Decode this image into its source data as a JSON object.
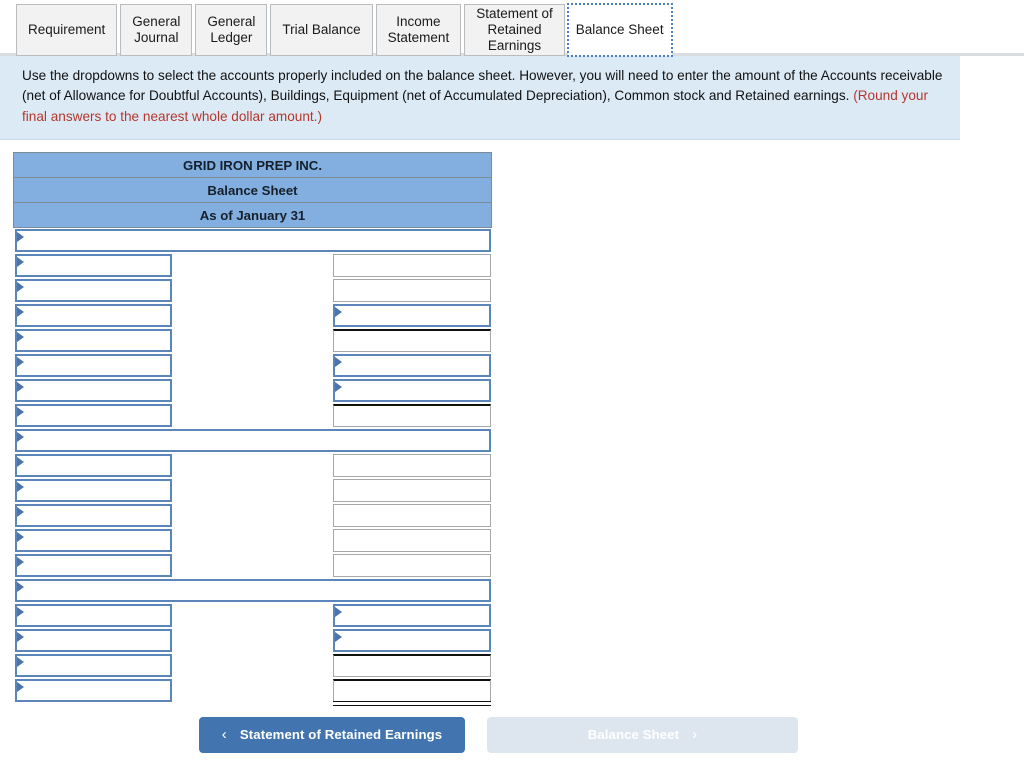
{
  "tabs": [
    {
      "label": "Requirement",
      "active": false
    },
    {
      "label": "General\nJournal",
      "active": false
    },
    {
      "label": "General\nLedger",
      "active": false
    },
    {
      "label": "Trial Balance",
      "active": false
    },
    {
      "label": "Income\nStatement",
      "active": false
    },
    {
      "label": "Statement of\nRetained\nEarnings",
      "active": false
    },
    {
      "label": "Balance Sheet",
      "active": true
    }
  ],
  "instructions": {
    "text": "Use the dropdowns to select the accounts properly included on the balance sheet. However, you will need to enter the amount of the Accounts receivable (net of Allowance for Doubtful Accounts), Buildings, Equipment (net of Accumulated Depreciation), Common stock and Retained earnings. ",
    "note": "(Round your final answers to the nearest whole dollar amount.)"
  },
  "statement": {
    "company": "GRID IRON PREP INC.",
    "title": "Balance Sheet",
    "period": "As of January 31",
    "rows": [
      {
        "span": true,
        "label": "",
        "label_select": true,
        "value": "",
        "value_kind": "none"
      },
      {
        "span": false,
        "label": "",
        "label_select": true,
        "value": "",
        "value_kind": "plain"
      },
      {
        "span": false,
        "label": "",
        "label_select": true,
        "value": "",
        "value_kind": "plain"
      },
      {
        "span": false,
        "label": "",
        "label_select": true,
        "value": "",
        "value_kind": "select"
      },
      {
        "span": false,
        "label": "",
        "label_select": true,
        "value": "",
        "value_kind": "ruled"
      },
      {
        "span": false,
        "label": "",
        "label_select": true,
        "value": "",
        "value_kind": "select"
      },
      {
        "span": false,
        "label": "",
        "label_select": true,
        "value": "",
        "value_kind": "select"
      },
      {
        "span": false,
        "label": "",
        "label_select": true,
        "value": "",
        "value_kind": "subtotal"
      },
      {
        "span": true,
        "label": "",
        "label_select": true,
        "value": "",
        "value_kind": "none"
      },
      {
        "span": false,
        "label": "",
        "label_select": true,
        "value": "",
        "value_kind": "plain"
      },
      {
        "span": false,
        "label": "",
        "label_select": true,
        "value": "",
        "value_kind": "plain"
      },
      {
        "span": false,
        "label": "",
        "label_select": true,
        "value": "",
        "value_kind": "plain"
      },
      {
        "span": false,
        "label": "",
        "label_select": true,
        "value": "",
        "value_kind": "plain"
      },
      {
        "span": false,
        "label": "",
        "label_select": true,
        "value": "",
        "value_kind": "plain"
      },
      {
        "span": true,
        "label": "",
        "label_select": true,
        "value": "",
        "value_kind": "none"
      },
      {
        "span": false,
        "label": "",
        "label_select": true,
        "value": "",
        "value_kind": "select"
      },
      {
        "span": false,
        "label": "",
        "label_select": true,
        "value": "",
        "value_kind": "select"
      },
      {
        "span": false,
        "label": "",
        "label_select": true,
        "value": "",
        "value_kind": "ruled"
      },
      {
        "span": false,
        "label": "",
        "label_select": true,
        "value": "",
        "value_kind": "total"
      }
    ]
  },
  "nav": {
    "prev_label": "Statement of Retained Earnings",
    "prev_chevron": "‹",
    "next_label": "Balance Sheet",
    "next_chevron": "›"
  },
  "colors": {
    "header_blue": "#82aee0",
    "instruction_bg": "#dceaf6",
    "note_red": "#b5372c",
    "select_border": "#5b86b9",
    "button_blue": "#4275b0",
    "button_disabled": "#dde5ee"
  }
}
